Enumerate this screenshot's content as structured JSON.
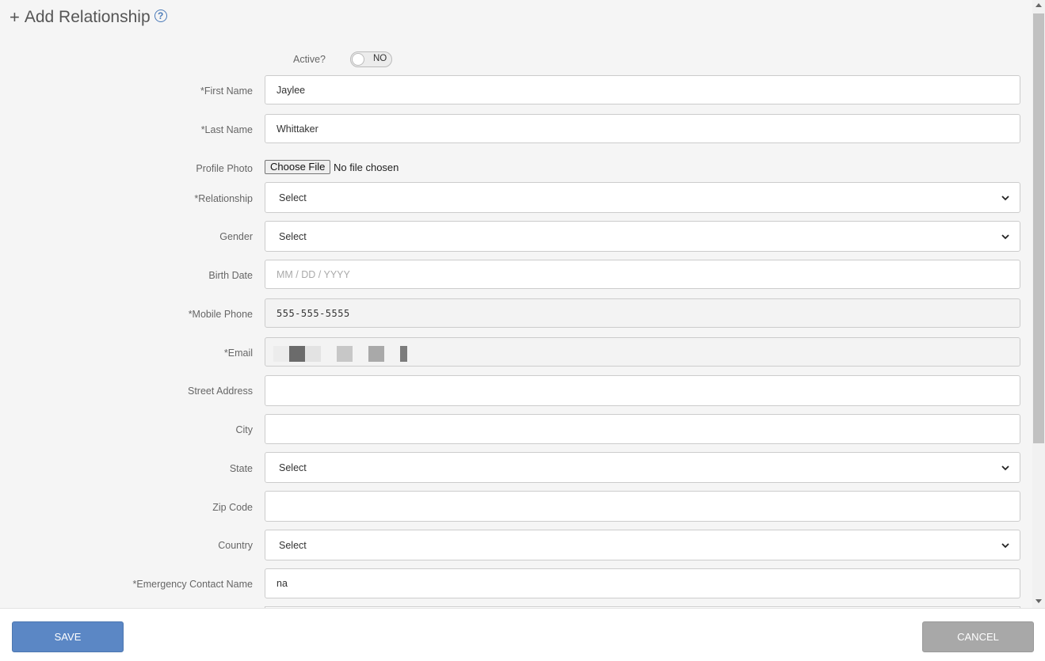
{
  "header": {
    "plus": "+",
    "title": "Add Relationship",
    "help_icon": "?"
  },
  "active": {
    "label": "Active?",
    "toggle_text": "NO",
    "value": false
  },
  "fields": {
    "first_name": {
      "label": "*First Name",
      "value": "Jaylee"
    },
    "last_name": {
      "label": "*Last Name",
      "value": "Whittaker"
    },
    "profile_photo": {
      "label": "Profile Photo",
      "button": "Choose File",
      "status": "No file chosen"
    },
    "relationship": {
      "label": "*Relationship",
      "value": "Select"
    },
    "gender": {
      "label": "Gender",
      "value": "Select"
    },
    "birth_date": {
      "label": "Birth Date",
      "placeholder": "MM / DD / YYYY"
    },
    "mobile_phone": {
      "label": "*Mobile Phone",
      "value": "555-555-5555"
    },
    "email": {
      "label": "*Email",
      "value": ""
    },
    "street_address": {
      "label": "Street Address",
      "value": ""
    },
    "city": {
      "label": "City",
      "value": ""
    },
    "state": {
      "label": "State",
      "value": "Select"
    },
    "zip_code": {
      "label": "Zip Code",
      "value": ""
    },
    "country": {
      "label": "Country",
      "value": "Select"
    },
    "emergency_contact_name": {
      "label": "*Emergency Contact Name",
      "value": "na"
    }
  },
  "footer": {
    "save_label": "SAVE",
    "cancel_label": "CANCEL"
  },
  "colors": {
    "save": "#5b87c5",
    "cancel": "#a8a8a8",
    "help": "#4a7ab8"
  }
}
